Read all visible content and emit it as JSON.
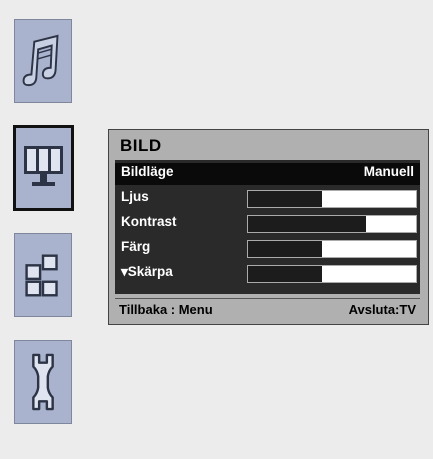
{
  "sidebar": {
    "items": [
      {
        "id": "sound",
        "icon": "music-note-icon"
      },
      {
        "id": "picture",
        "icon": "monitor-icon",
        "selected": true
      },
      {
        "id": "features",
        "icon": "squares-icon"
      },
      {
        "id": "setup",
        "icon": "wrench-icon"
      }
    ]
  },
  "panel": {
    "title": "BILD",
    "rows": [
      {
        "label": "Bildläge",
        "value": "Manuell",
        "selected": true
      },
      {
        "label": "Ljus",
        "level": 0.44
      },
      {
        "label": "Kontrast",
        "level": 0.7
      },
      {
        "label": "Färg",
        "level": 0.44
      },
      {
        "label": "▾Skärpa",
        "level": 0.44
      }
    ],
    "footer": {
      "back": "Tillbaka : Menu",
      "exit": "Avsluta:TV"
    }
  },
  "colors": {
    "tile": "#a9b3cd",
    "panel": "#b0b0b0",
    "panel_inner": "#2a2a2a"
  }
}
